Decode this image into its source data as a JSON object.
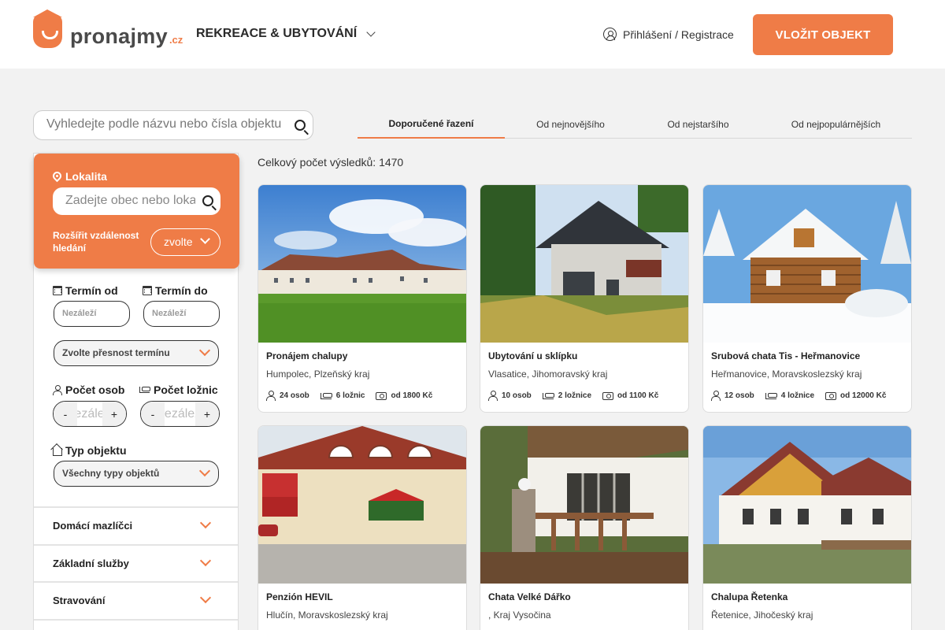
{
  "header": {
    "logo_text": "pronajmy",
    "logo_tld": ".cz",
    "category": "REKREACE & UBYTOVÁNÍ",
    "login": "Přihlášení / Registrace",
    "add_button": "VLOŽIT OBJEKT"
  },
  "search": {
    "placeholder": "Vyhledejte podle názvu nebo čísla objektu"
  },
  "sort_tabs": [
    "Doporučené řazení",
    "Od nejnovějšího",
    "Od nejstaršího",
    "Od nejpopulárnějších"
  ],
  "filters": {
    "location_label": "Lokalita",
    "location_placeholder": "Zadejte obec nebo lokalitu",
    "radius_label": "Rozšířit vzdálenost hledání",
    "radius_value": "zvolte",
    "date_from_label": "Termín od",
    "date_to_label": "Termín do",
    "date_from_value": "Nezáleží",
    "date_to_value": "Nezáleží",
    "precision_value": "Zvolte přesnost termínu",
    "persons_label": "Počet osob",
    "bedrooms_label": "Počet ložnic",
    "persons_value": "Nezáleží",
    "bedrooms_value": "Nezáleží",
    "minus": "-",
    "plus": "+",
    "type_label": "Typ objektu",
    "type_value": "Všechny typy objektů",
    "sections": [
      "Domácí mazlíčci",
      "Základní služby",
      "Stravování"
    ]
  },
  "results": {
    "total_text": "Celkový počet výsledků: 1470",
    "cards": [
      {
        "title": "Pronájem chalupy",
        "place": "Humpolec, Plzeňský kraj",
        "persons": "24 osob",
        "bedrooms": "6 ložnic",
        "price": "od 1800 Kč"
      },
      {
        "title": "Ubytování u sklípku",
        "place": "Vlasatice, Jihomoravský kraj",
        "persons": "10 osob",
        "bedrooms": "2 ložnice",
        "price": "od 1100 Kč"
      },
      {
        "title": "Srubová chata Tis - Heřmanovice",
        "place": "Heřmanovice, Moravskoslezský kraj",
        "persons": "12 osob",
        "bedrooms": "4 ložnice",
        "price": "od 12000 Kč"
      },
      {
        "title": "Penzión HEVIL",
        "place": "Hlučín, Moravskoslezský kraj"
      },
      {
        "title": "Chata Velké Dářko",
        "place": ", Kraj Vysočina"
      },
      {
        "title": "Chalupa Řetenka",
        "place": "Řetenice, Jihočeský kraj"
      }
    ]
  },
  "colors": {
    "accent": "#ef7c47",
    "background": "#f2f2f2"
  }
}
